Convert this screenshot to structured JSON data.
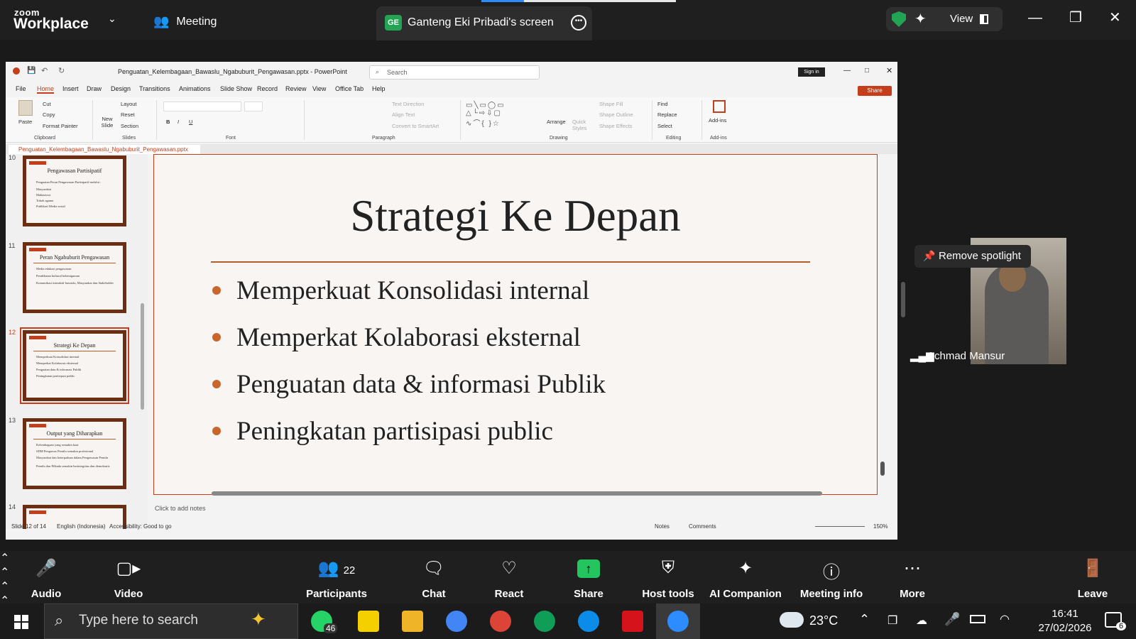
{
  "zoom": {
    "brand_small": "zoom",
    "brand": "Workplace",
    "meeting_label": "Meeting",
    "screen_badge": "GE",
    "screen_label": "Ganteng Eki Pribadi's screen",
    "view_label": "View",
    "accent": "#2d8cff"
  },
  "ppt": {
    "filename_title": "Penguatan_Kelembagaan_Bawaslu_Ngabuburit_Pengawasan.pptx  -  PowerPoint",
    "search_placeholder": "Search",
    "signin": "Sign in",
    "share": "Share",
    "menu": [
      "File",
      "Home",
      "Insert",
      "Draw",
      "Design",
      "Transitions",
      "Animations",
      "Slide Show",
      "Record",
      "Review",
      "View",
      "Office Tab",
      "Help"
    ],
    "ribbon": {
      "paste": "Paste",
      "cut": "Cut",
      "copy": "Copy",
      "format_painter": "Format Painter",
      "new_slide": "New Slide",
      "layout": "Layout",
      "reset": "Reset",
      "section": "Section",
      "text_direction": "Text Direction",
      "align_text": "Align Text",
      "convert_smartart": "Convert to SmartArt",
      "arrange": "Arrange",
      "quick_styles": "Quick Styles",
      "shape_fill": "Shape Fill",
      "shape_outline": "Shape Outline",
      "shape_effects": "Shape Effects",
      "find": "Find",
      "replace": "Replace",
      "select": "Select",
      "addins": "Add-ins",
      "groups": [
        "Clipboard",
        "Slides",
        "Font",
        "Paragraph",
        "Drawing",
        "Editing",
        "Add-ins"
      ]
    },
    "doc_tab": "Penguatan_Kelembagaan_Bawaslu_Ngabuburit_Pengawasan.pptx",
    "thumbnails": [
      {
        "num": "10",
        "title": "Pengawasan Partisipatif",
        "lines": [
          "Penguatan Peran Pengawasan Partisipatif melalui :",
          "Masyarakat",
          "Mahasiswa",
          "Tokoh agama",
          "Publikasi Media sosial"
        ]
      },
      {
        "num": "11",
        "title": "Peran Ngabuburit Pengawasan",
        "lines": [
          "Media edukasi pengawasan",
          "Pendekatan kultural keberagaman",
          "Komunikasi interaktif bawaslu, Masyarakat dan Stakeholder"
        ]
      },
      {
        "num": "12",
        "title": "Strategi Ke Depan",
        "lines": [
          "Memperkuat Konsolidasi internal",
          "Memperkat Kolaborasi eksternal",
          "Penguatan data & informasi Publik",
          "Peningkatan partisipasi public"
        ]
      },
      {
        "num": "13",
        "title": "Output yang Diharapkan",
        "lines": [
          "Kelembagaan yang semakin kuat",
          "SDM Pengawas Pemilu semakin profesional",
          "Masyarakat dan keterpaduan dalam Pengawasan Pemilu",
          "Pemilu dan Pilkada semakin berintegritas dan demokratis"
        ]
      },
      {
        "num": "14",
        "title": "",
        "lines": []
      }
    ],
    "slide": {
      "title": "Strategi Ke Depan",
      "bullets": [
        "Memperkuat Konsolidasi internal",
        "Memperkat Kolaborasi eksternal",
        "Penguatan data & informasi Publik",
        "Peningkatan partisipasi public"
      ]
    },
    "notes_placeholder": "Click to add notes",
    "status": {
      "slide": "Slide 12 of 14",
      "language": "English (Indonesia)",
      "accessibility": "Accessibility: Good to go",
      "notes": "Notes",
      "comments": "Comments",
      "zoom": "150%"
    }
  },
  "video": {
    "spotlight_label": "Remove spotlight",
    "participant_name": "Achmad Mansur"
  },
  "toolbar": {
    "audio": "Audio",
    "video": "Video",
    "participants": "Participants",
    "participants_count": "22",
    "chat": "Chat",
    "react": "React",
    "share": "Share",
    "host_tools": "Host tools",
    "ai_companion": "AI Companion",
    "meeting_info": "Meeting info",
    "more": "More",
    "leave": "Leave"
  },
  "taskbar": {
    "search_placeholder": "Type here to search",
    "whatsapp_badge": "46",
    "temperature": "23°C",
    "time": "16:41",
    "date": "27/02/2026",
    "notif_count": "6"
  }
}
